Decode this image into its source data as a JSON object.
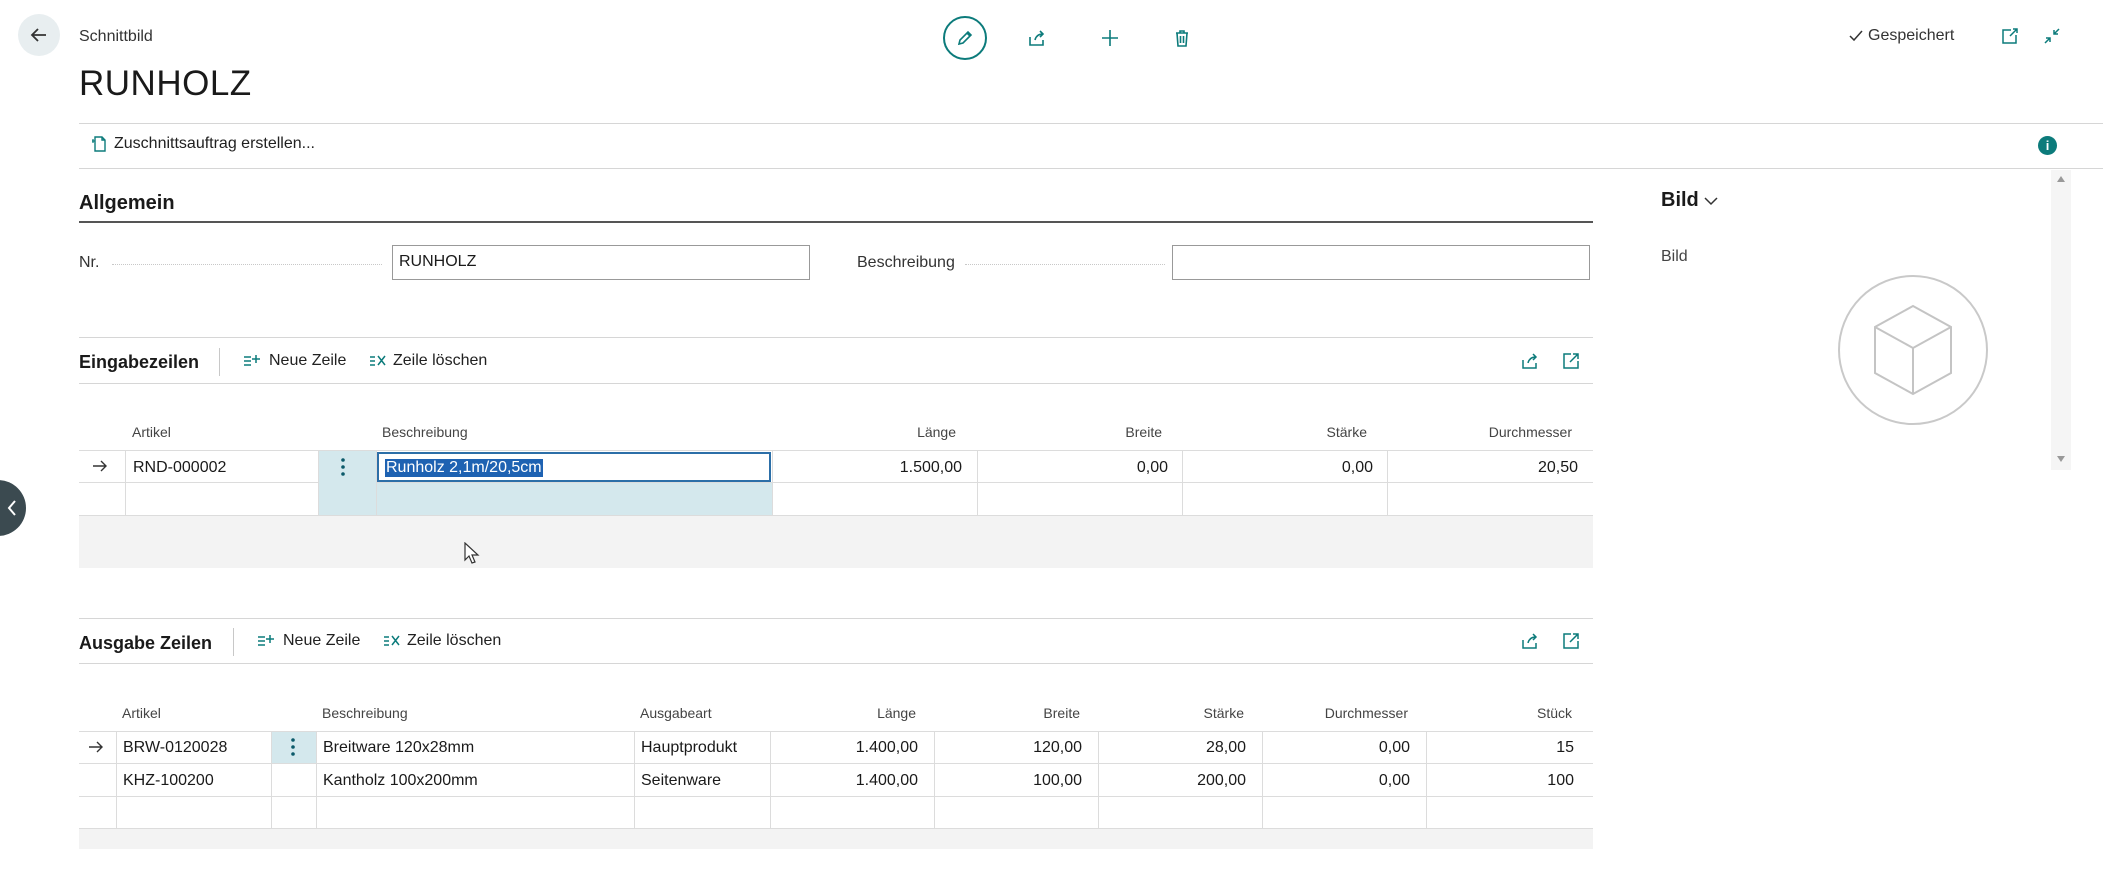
{
  "header": {
    "breadcrumb": "Schnittbild",
    "title": "RUNHOLZ",
    "status": "Gespeichert"
  },
  "actions": {
    "create_cut_order": "Zuschnittsauftrag erstellen..."
  },
  "general": {
    "section_title": "Allgemein",
    "nr_label": "Nr.",
    "nr_value": "RUNHOLZ",
    "desc_label": "Beschreibung",
    "desc_value": ""
  },
  "input_lines": {
    "title": "Eingabezeilen",
    "new_line": "Neue Zeile",
    "delete_line": "Zeile löschen",
    "columns": {
      "artikel": "Artikel",
      "beschreibung": "Beschreibung",
      "laenge": "Länge",
      "breite": "Breite",
      "staerke": "Stärke",
      "durchmesser": "Durchmesser"
    },
    "rows": [
      {
        "artikel": "RND-000002",
        "beschreibung": "Runholz 2,1m/20,5cm",
        "laenge": "1.500,00",
        "breite": "0,00",
        "staerke": "0,00",
        "durchmesser": "20,50"
      }
    ]
  },
  "output_lines": {
    "title": "Ausgabe Zeilen",
    "new_line": "Neue Zeile",
    "delete_line": "Zeile löschen",
    "columns": {
      "artikel": "Artikel",
      "beschreibung": "Beschreibung",
      "ausgabeart": "Ausgabeart",
      "laenge": "Länge",
      "breite": "Breite",
      "staerke": "Stärke",
      "durchmesser": "Durchmesser",
      "stueck": "Stück"
    },
    "rows": [
      {
        "artikel": "BRW-0120028",
        "beschreibung": "Breitware 120x28mm",
        "ausgabeart": "Hauptprodukt",
        "laenge": "1.400,00",
        "breite": "120,00",
        "staerke": "28,00",
        "durchmesser": "0,00",
        "stueck": "15"
      },
      {
        "artikel": "KHZ-100200",
        "beschreibung": "Kantholz 100x200mm",
        "ausgabeart": "Seitenware",
        "laenge": "1.400,00",
        "breite": "100,00",
        "staerke": "200,00",
        "durchmesser": "0,00",
        "stueck": "100"
      }
    ]
  },
  "factbox": {
    "title": "Bild",
    "label": "Bild"
  },
  "colors": {
    "accent": "#0c7b7b",
    "selection": "#1e62b2",
    "selected_cell": "#d4e8ed"
  },
  "icons": [
    "back-arrow-icon",
    "edit-pencil-icon",
    "share-icon",
    "plus-icon",
    "delete-icon",
    "checkmark-icon",
    "open-new-window-icon",
    "collapse-icon",
    "document-icon",
    "info-icon",
    "new-line-icon",
    "delete-line-icon",
    "expand-icon",
    "chevron-down-icon",
    "cube-placeholder-icon",
    "row-arrow-icon",
    "more-options-icon"
  ]
}
